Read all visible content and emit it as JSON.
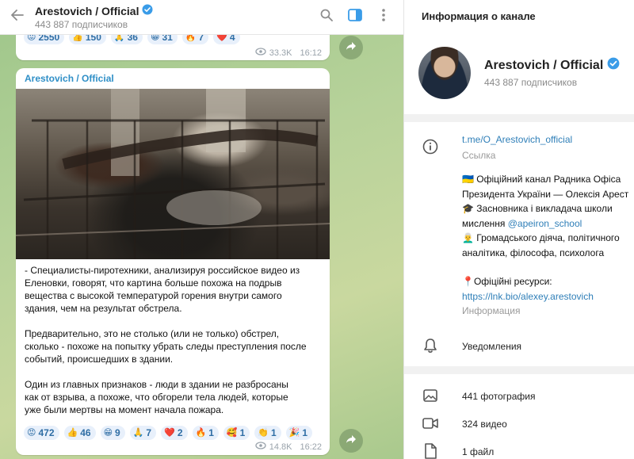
{
  "header": {
    "title": "Arestovich / Official",
    "subtitle": "443 887 подписчиков"
  },
  "prev_message": {
    "reactions": [
      {
        "emoji": "😡",
        "count": "2550"
      },
      {
        "emoji": "👍",
        "count": "150"
      },
      {
        "emoji": "🙏",
        "count": "36"
      },
      {
        "emoji": "😁",
        "count": "31"
      },
      {
        "emoji": "🔥",
        "count": "7"
      },
      {
        "emoji": "❤️",
        "count": "4"
      }
    ],
    "views": "33.3K",
    "time": "16:12"
  },
  "message": {
    "author": "Arestovich / Official",
    "paragraphs": [
      [
        "- Специалисты-пиротехники, анализируя российское видео из",
        "Еленовки, говорят, что картина больше похожа на подрыв",
        "вещества с высокой температурой горения внутри самого",
        "здания, чем на результат обстрела."
      ],
      [
        "Предварительно, это не столько (или не только) обстрел,",
        "сколько - похоже на попытку убрать следы преступления после",
        "событий, происшедших в здании."
      ],
      [
        "Один из главных признаков - люди в здании не разбросаны",
        "как от взрыва, а похоже, что обгорели тела людей, которые",
        "уже были мертвы на момент начала пожара."
      ]
    ],
    "reactions": [
      {
        "emoji": "😡",
        "count": "472"
      },
      {
        "emoji": "👍",
        "count": "46"
      },
      {
        "emoji": "😁",
        "count": "9"
      },
      {
        "emoji": "🙏",
        "count": "7"
      },
      {
        "emoji": "❤️",
        "count": "2"
      },
      {
        "emoji": "🔥",
        "count": "1"
      },
      {
        "emoji": "🥰",
        "count": "1"
      },
      {
        "emoji": "👏",
        "count": "1"
      },
      {
        "emoji": "🎉",
        "count": "1"
      }
    ],
    "views": "14.8K",
    "time": "16:22"
  },
  "info": {
    "title": "Информация о канале",
    "name": "Arestovich / Official",
    "subscribers": "443 887 подписчиков",
    "link": "t.me/O_Arestovich_official",
    "link_label": "Ссылка",
    "desc_line1": "🇺🇦 Офіційний канал Радника Офіса",
    "desc_line2": "Президента України — Олексія Арест",
    "desc_line3": "🎓 Засновника і викладача школи",
    "desc_line4_prefix": "мислення ",
    "desc_line4_mention": "@apeiron_school",
    "desc_line5": "👨‍🦳 Громадського діяча, політичного",
    "desc_line6": "аналітика, філософа, психолога",
    "desc_line7": "📍Офіційні ресурси:",
    "desc_line8": "https://lnk.bio/alexey.arestovich",
    "desc_label": "Информация",
    "notifications": "Уведомления",
    "photos": "441 фотография",
    "videos": "324 видео",
    "files": "1 файл"
  }
}
